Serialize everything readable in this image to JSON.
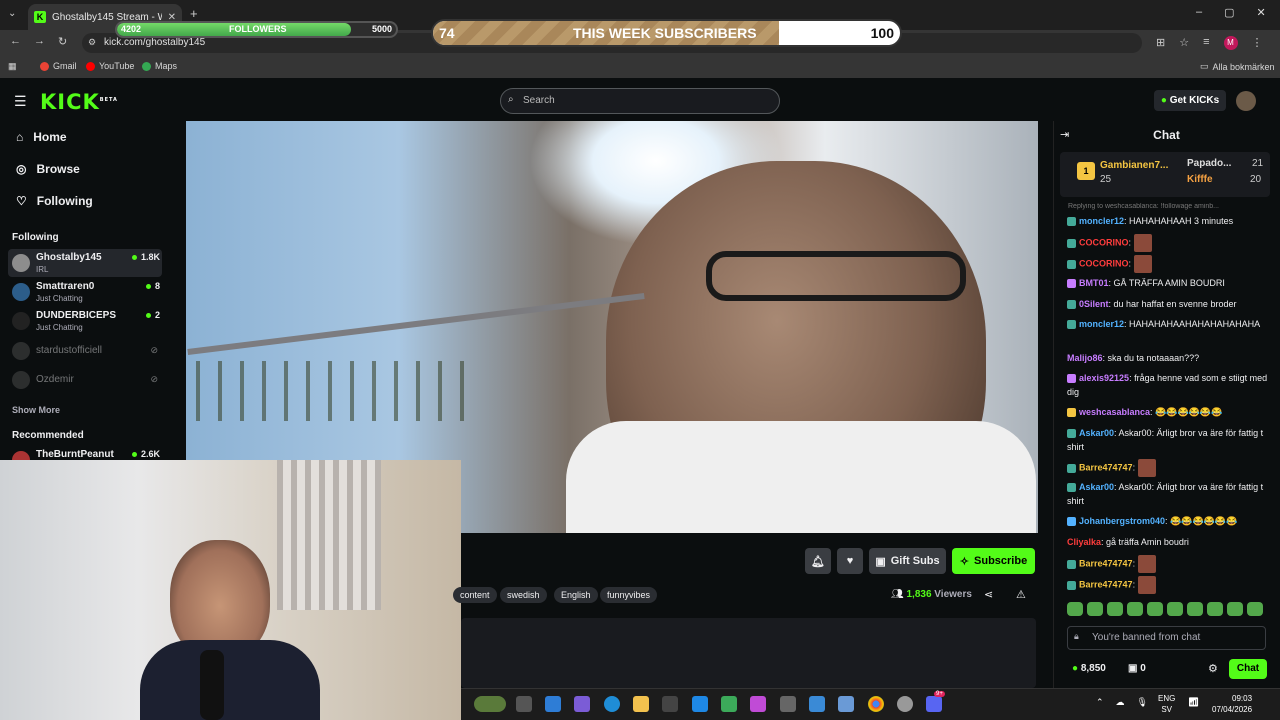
{
  "browser": {
    "tab_title": "Ghostalby145 Stream - Wa",
    "tab_close": "✕",
    "new_tab": "+",
    "url": "kick.com/ghostalby145",
    "bookmarks": [
      "Gmail",
      "YouTube",
      "Maps"
    ],
    "all_bookmarks": "Alla bokmärken",
    "profile_initial": "M"
  },
  "overlay": {
    "followers_current": "4202",
    "followers_label": "FOLLOWERS",
    "followers_goal": "5000",
    "followers_progress": 0.84,
    "subs_current": "74",
    "subs_label": "THIS WEEK SUBSCRIBERS",
    "subs_goal": "100",
    "subs_progress": 0.74
  },
  "header": {
    "logo": "KICK",
    "logo_badge": "BETA",
    "search_placeholder": "Search",
    "get_kicks": "Get KICKs"
  },
  "sidebar": {
    "nav": [
      {
        "label": "Home",
        "icon": "home-icon"
      },
      {
        "label": "Browse",
        "icon": "compass-icon"
      },
      {
        "label": "Following",
        "icon": "heart-icon"
      }
    ],
    "following_title": "Following",
    "following": [
      {
        "name": "Ghostalby145",
        "category": "IRL",
        "viewers": "1.8K"
      },
      {
        "name": "Smattraren0",
        "category": "Just Chatting",
        "viewers": "8"
      },
      {
        "name": "DUNDERBICEPS",
        "category": "Just Chatting",
        "viewers": "2"
      },
      {
        "name": "stardustofficiell",
        "category": "",
        "viewers": ""
      },
      {
        "name": "Ozdemir",
        "category": "",
        "viewers": ""
      }
    ],
    "show_more": "Show More",
    "recommended_title": "Recommended",
    "recommended": [
      {
        "name": "TheBurntPeanut",
        "viewers": "2.6K"
      }
    ]
  },
  "stream": {
    "gift_subs": "Gift Subs",
    "subscribe": "Subscribe",
    "tags": [
      "content",
      "swedish",
      "English",
      "funnyvibes"
    ],
    "viewers_count": "1,836",
    "viewers_label": "Viewers"
  },
  "chat": {
    "title": "Chat",
    "leaderboard": [
      {
        "rank": "1",
        "name": "Gambianen7...",
        "count": "25"
      },
      {
        "name": "Papado...",
        "count": "21"
      },
      {
        "name": "Kifffe",
        "count": "20"
      }
    ],
    "reply_hint": "Replying to weshcasablanca: !followage aminb...",
    "messages": [
      {
        "user": "moncler12",
        "text": "HAHAHAHAAH 3 minutes",
        "color": "#53b2ff"
      },
      {
        "user": "COCORINO",
        "text": "",
        "color": "#ff3d3d",
        "emote": true
      },
      {
        "user": "COCORINO",
        "text": "",
        "color": "#ff3d3d",
        "emote": true
      },
      {
        "user": "BMT01",
        "text": "GÅ TRÄFFA AMIN BOUDRI",
        "color": "#c77dff"
      },
      {
        "user": "0Silent",
        "text": "du har haffat en svenne broder",
        "color": "#c77dff"
      },
      {
        "user": "moncler12",
        "text": "HAHAHAHAAHAHAHAHAHAHA",
        "color": "#53b2ff"
      },
      {
        "user": "Malijo86",
        "text": "ska du ta notaaaan???",
        "color": "#c77dff"
      },
      {
        "user": "alexis92125",
        "text": "fråga henne vad som e stiigt med dig",
        "color": "#c77dff"
      },
      {
        "user": "weshcasablanca",
        "text": "😂😂😂😂😂😂",
        "color": "#c77dff"
      },
      {
        "user": "Askar00",
        "text": "Askar00: Ärligt bror va äre för fattig t shirt",
        "color": "#53b2ff"
      },
      {
        "user": "Barre474747",
        "text": "",
        "color": "#f4c542",
        "emote": true
      },
      {
        "user": "Askar00",
        "text": "Askar00: Ärligt bror va äre för fattig t shirt",
        "color": "#53b2ff"
      },
      {
        "user": "Johanbergstrom040",
        "text": "😂😂😂😂😂😂",
        "color": "#53b2ff"
      },
      {
        "user": "Cliyalka",
        "text": "gå träffa Amin boudri",
        "color": "#ff3d3d"
      },
      {
        "user": "Barre474747",
        "text": "",
        "color": "#f4c542",
        "emote": true
      },
      {
        "user": "Barre474747",
        "text": "",
        "color": "#f4c542",
        "emote": true
      }
    ],
    "banned_placeholder": "You're banned from chat",
    "kicks_balance": "8,850",
    "points": "0",
    "chat_button": "Chat"
  },
  "taskbar": {
    "lang": "ENG",
    "region": "SV",
    "time": "09:03",
    "date": "07/04/2026",
    "notif_badge": "9+"
  },
  "colors": {
    "kick_green": "#53fc18",
    "bg": "#0b0e0f"
  }
}
